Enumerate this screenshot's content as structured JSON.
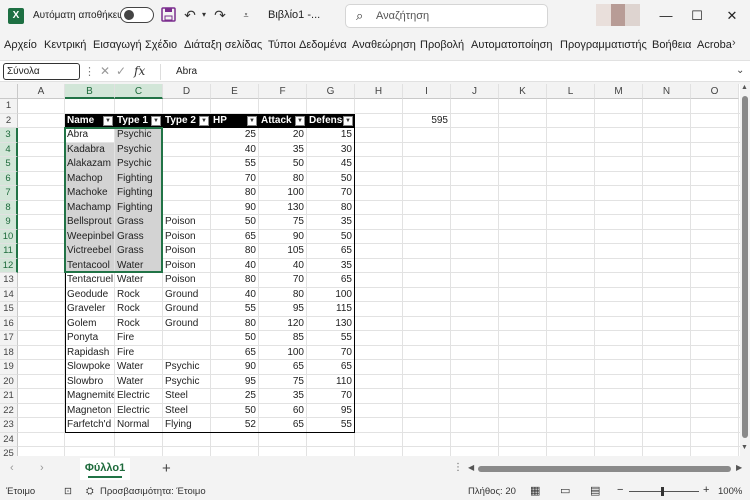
{
  "titlebar": {
    "app_icon": "excel-logo",
    "autosave_label": "Αυτόματη αποθήκευση",
    "doc_title": "Βιβλίο1 -...",
    "search_placeholder": "Αναζήτηση",
    "minimize": "—",
    "maximize": "☐",
    "close": "✕"
  },
  "ribbon": {
    "tabs": [
      "Αρχείο",
      "Κεντρική",
      "Εισαγωγή",
      "Σχέδιο",
      "Διάταξη σελίδας",
      "Τύποι",
      "Δεδομένα",
      "Αναθεώρηση",
      "Προβολή",
      "Αυτοματοποίηση",
      "Προγραμματιστής",
      "Βοήθεια",
      "Acroba"
    ]
  },
  "formula_bar": {
    "name_box": "Σύνολα",
    "fx": "fx",
    "value": "Abra"
  },
  "grid": {
    "columns": [
      "A",
      "B",
      "C",
      "D",
      "E",
      "F",
      "G",
      "H",
      "I",
      "J",
      "K",
      "L",
      "M",
      "N",
      "O"
    ],
    "rows": [
      "1",
      "2",
      "3",
      "4",
      "5",
      "6",
      "7",
      "8",
      "9",
      "10",
      "11",
      "12",
      "13",
      "14",
      "15",
      "16",
      "17",
      "18",
      "19",
      "20",
      "21",
      "22",
      "23",
      "24",
      "25"
    ],
    "i2_value": "595",
    "table_headers": [
      "Name",
      "Type 1",
      "Type 2",
      "HP",
      "Attack",
      "Defense"
    ],
    "table_rows": [
      [
        "Abra",
        "Psychic",
        "",
        "25",
        "20",
        "15"
      ],
      [
        "Kadabra",
        "Psychic",
        "",
        "40",
        "35",
        "30"
      ],
      [
        "Alakazam",
        "Psychic",
        "",
        "55",
        "50",
        "45"
      ],
      [
        "Machop",
        "Fighting",
        "",
        "70",
        "80",
        "50"
      ],
      [
        "Machoke",
        "Fighting",
        "",
        "80",
        "100",
        "70"
      ],
      [
        "Machamp",
        "Fighting",
        "",
        "90",
        "130",
        "80"
      ],
      [
        "Bellsprout",
        "Grass",
        "Poison",
        "50",
        "75",
        "35"
      ],
      [
        "Weepinbell",
        "Grass",
        "Poison",
        "65",
        "90",
        "50"
      ],
      [
        "Victreebel",
        "Grass",
        "Poison",
        "80",
        "105",
        "65"
      ],
      [
        "Tentacool",
        "Water",
        "Poison",
        "40",
        "40",
        "35"
      ],
      [
        "Tentacruel",
        "Water",
        "Poison",
        "80",
        "70",
        "65"
      ],
      [
        "Geodude",
        "Rock",
        "Ground",
        "40",
        "80",
        "100"
      ],
      [
        "Graveler",
        "Rock",
        "Ground",
        "55",
        "95",
        "115"
      ],
      [
        "Golem",
        "Rock",
        "Ground",
        "80",
        "120",
        "130"
      ],
      [
        "Ponyta",
        "Fire",
        "",
        "50",
        "85",
        "55"
      ],
      [
        "Rapidash",
        "Fire",
        "",
        "65",
        "100",
        "70"
      ],
      [
        "Slowpoke",
        "Water",
        "Psychic",
        "90",
        "65",
        "65"
      ],
      [
        "Slowbro",
        "Water",
        "Psychic",
        "95",
        "75",
        "110"
      ],
      [
        "Magnemite",
        "Electric",
        "Steel",
        "25",
        "35",
        "70"
      ],
      [
        "Magneton",
        "Electric",
        "Steel",
        "50",
        "60",
        "95"
      ],
      [
        "Farfetch'd",
        "Normal",
        "Flying",
        "52",
        "65",
        "55"
      ]
    ]
  },
  "sheets": {
    "active": "Φύλλο1",
    "add": "+"
  },
  "status": {
    "ready": "Έτοιμο",
    "accessibility": "Προσβασιμότητα: Έτοιμο",
    "count": "Πλήθος: 20",
    "zoom": "100%",
    "zoom_minus": "−",
    "zoom_plus": "+"
  },
  "colors": {
    "excel_green": "#217346",
    "selection_fill": "#d3d3d3",
    "header_fill": "#000000"
  }
}
